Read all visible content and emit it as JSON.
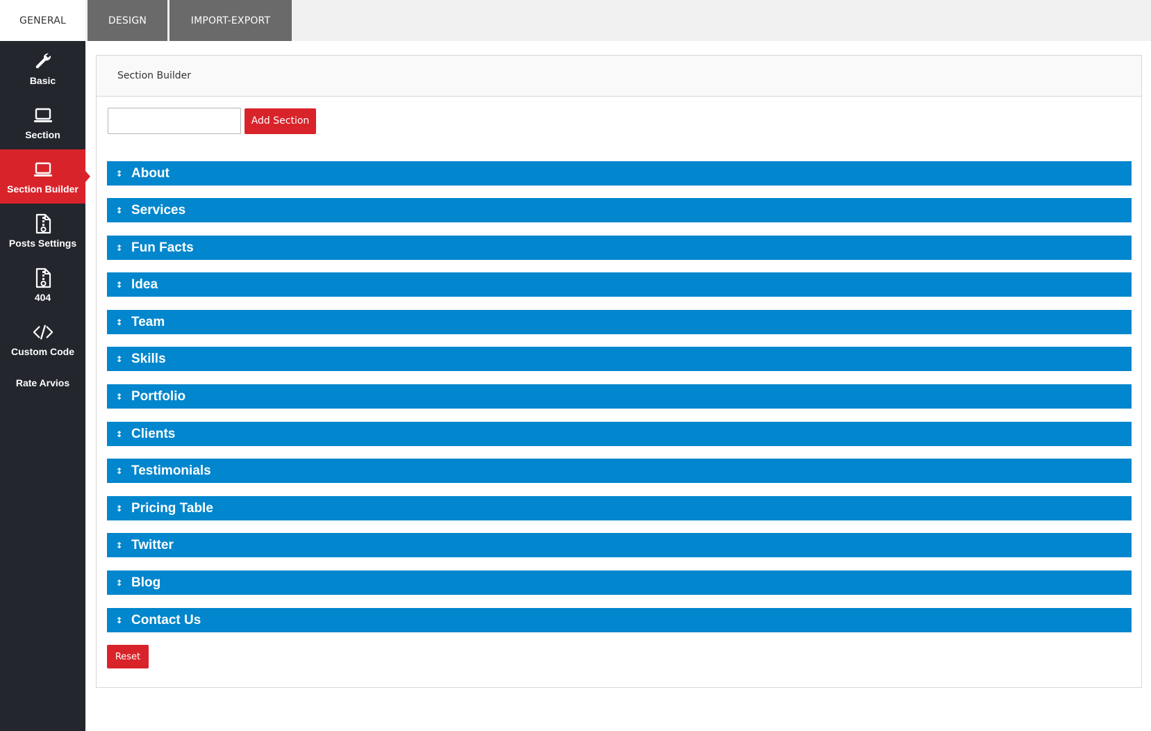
{
  "tabs": [
    {
      "label": "GENERAL",
      "active": true
    },
    {
      "label": "DESIGN",
      "active": false
    },
    {
      "label": "IMPORT-EXPORT",
      "active": false
    }
  ],
  "sidebar": {
    "items": [
      {
        "label": "Basic",
        "icon": "wrench-icon"
      },
      {
        "label": "Section",
        "icon": "laptop-icon"
      },
      {
        "label": "Section Builder",
        "icon": "laptop-icon",
        "active": true
      },
      {
        "label": "Posts Settings",
        "icon": "file-zip-icon"
      },
      {
        "label": "404",
        "icon": "file-zip-icon"
      },
      {
        "label": "Custom Code",
        "icon": "code-icon"
      },
      {
        "label": "Rate Arvios"
      }
    ]
  },
  "panel": {
    "title": "Section Builder",
    "input_value": "",
    "add_button_label": "Add Section",
    "reset_button_label": "Reset",
    "drag_glyph": "↕",
    "sections": [
      "About",
      "Services",
      "Fun Facts",
      "Idea",
      "Team",
      "Skills",
      "Portfolio",
      "Clients",
      "Testimonials",
      "Pricing Table",
      "Twitter",
      "Blog",
      "Contact Us"
    ]
  },
  "colors": {
    "sidebar_bg": "#23262d",
    "accent_red": "#d9232a",
    "section_blue": "#0286cd",
    "inactive_tab": "#6a6a6a"
  }
}
